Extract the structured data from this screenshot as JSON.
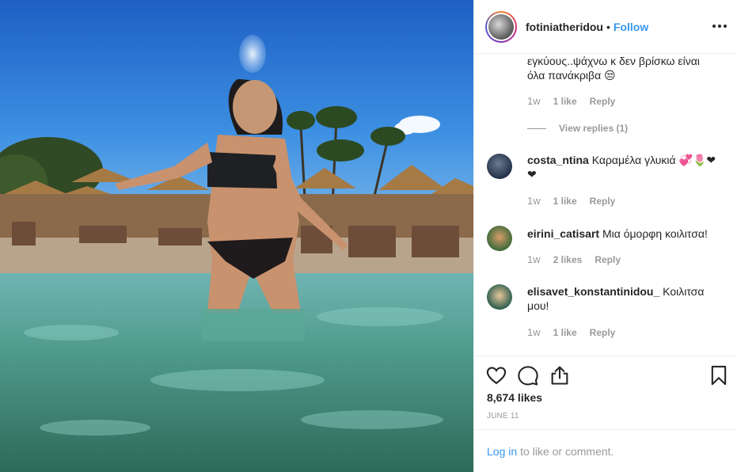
{
  "post": {
    "username": "fotiniatheridou",
    "separator": "•",
    "follow_label": "Follow",
    "more_icon": "more-options-icon"
  },
  "comments": [
    {
      "username": "",
      "text": "εγκύους..ψάχνω κ δεν βρίσκω είναι όλα πανάκριβα 😒",
      "time": "1w",
      "likes": "1 like",
      "reply": "Reply",
      "view_replies": "View replies (1)"
    },
    {
      "username": "costa_ntina",
      "text": "Καραμέλα γλυκιά 💞🌷❤ ❤",
      "time": "1w",
      "likes": "1 like",
      "reply": "Reply"
    },
    {
      "username": "eirini_catisart",
      "text": "Μια όμορφη κοιλιτσα!",
      "time": "1w",
      "likes": "2 likes",
      "reply": "Reply"
    },
    {
      "username": "elisavet_konstantinidou_",
      "text": "Κοιλιτσα μου!",
      "time": "1w",
      "likes": "1 like",
      "reply": "Reply"
    }
  ],
  "actions": {
    "like_icon": "heart-icon",
    "comment_icon": "comment-icon",
    "share_icon": "share-icon",
    "save_icon": "bookmark-icon"
  },
  "likes_count": "8,674 likes",
  "date": "JUNE 11",
  "login": {
    "link": "Log in",
    "rest": "to like or comment."
  },
  "colors": {
    "link": "#3897f0",
    "text": "#262626",
    "muted": "#999999",
    "border": "#efefef"
  }
}
